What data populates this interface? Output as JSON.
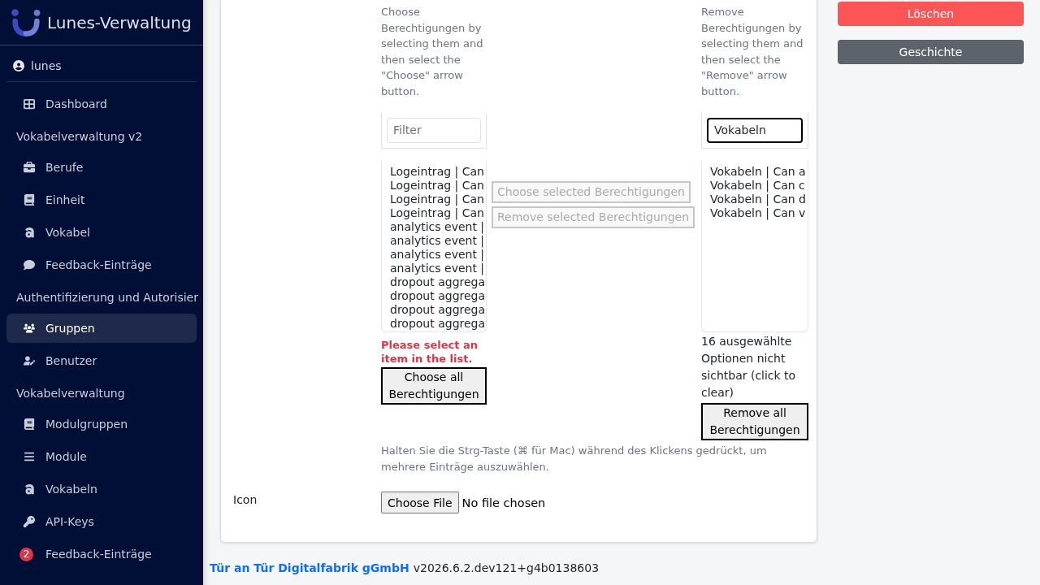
{
  "sidebar": {
    "title": "Lunes-Verwaltung",
    "user": "lunes",
    "nav": [
      {
        "kind": "item",
        "label": "Dashboard",
        "selected": false
      },
      {
        "kind": "section",
        "label": "Vokabelverwaltung v2"
      },
      {
        "kind": "item",
        "label": "Berufe",
        "selected": false
      },
      {
        "kind": "item",
        "label": "Einheit",
        "selected": false
      },
      {
        "kind": "item",
        "label": "Vokabel",
        "selected": false
      },
      {
        "kind": "item",
        "label": "Feedback-Einträge",
        "selected": false
      },
      {
        "kind": "section",
        "label": "Authentifizierung und Autorisier"
      },
      {
        "kind": "item",
        "label": "Gruppen",
        "selected": true
      },
      {
        "kind": "item",
        "label": "Benutzer",
        "selected": false
      },
      {
        "kind": "section",
        "label": "Vokabelverwaltung"
      },
      {
        "kind": "item",
        "label": "Modulgruppen",
        "selected": false
      },
      {
        "kind": "item",
        "label": "Module",
        "selected": false
      },
      {
        "kind": "item",
        "label": "Vokabeln",
        "selected": false
      },
      {
        "kind": "item",
        "label": "API-Keys",
        "selected": false
      },
      {
        "kind": "item",
        "label": "Feedback-Einträge",
        "selected": false,
        "badge": "2"
      }
    ]
  },
  "form": {
    "permissions": {
      "available": {
        "help": "Choose Berechtigungen by selecting them and then select the \"Choose\" arrow button.",
        "filter": {
          "placeholder": "Filter",
          "focused": false
        },
        "options": [
          "Logeintrag | Can",
          "Logeintrag | Can",
          "Logeintrag | Can",
          "Logeintrag | Can",
          "analytics event |",
          "analytics event |",
          "analytics event |",
          "analytics event |",
          "dropout aggrega",
          "dropout aggrega",
          "dropout aggrega",
          "dropout aggrega"
        ],
        "error": "Please select an item in the list.",
        "button": "Choose all Berechtigungen"
      },
      "moves": [
        {
          "label": "Choose selected Berechtigungen",
          "disabled": true
        },
        {
          "label": "Remove selected Berechtigungen",
          "disabled": true
        }
      ],
      "chosen": {
        "help": "Remove Berechtigungen by selecting them and then select the \"Remove\" arrow button.",
        "filter": {
          "value": "Vokabeln",
          "focused": true
        },
        "options": [
          "Vokabeln | Can a",
          "Vokabeln | Can c",
          "Vokabeln | Can d",
          "Vokabeln | Can v"
        ],
        "hidden_note": "16 ausgewählte Optionen nicht sichtbar (click to clear)",
        "button": "Remove all Berechtigungen"
      },
      "help": "Halten Sie die Strg-Taste (⌘ für Mac) während des Klickens gedrückt, um mehrere Einträge auszuwählen."
    },
    "icon": {
      "label": "Icon",
      "button": "Choose File",
      "status": "No file chosen"
    }
  },
  "actions": [
    {
      "kind": "danger",
      "label": "Löschen"
    },
    {
      "kind": "secondary",
      "label": "Geschichte"
    }
  ],
  "footer": {
    "company": "Tür an Tür Digitalfabrik gGmbH",
    "version": "v2026.6.2.dev121+g4b0138603"
  }
}
